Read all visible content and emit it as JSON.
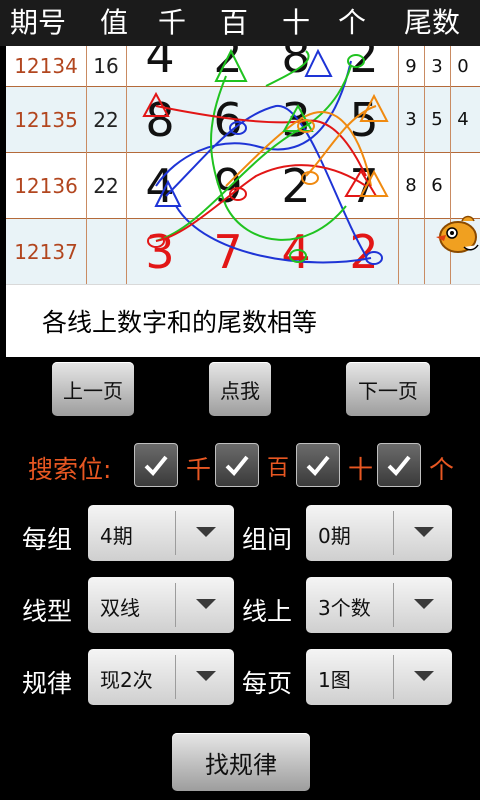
{
  "header": {
    "columns": [
      "期号",
      "值",
      "千",
      "百",
      "十",
      "个",
      "尾数"
    ]
  },
  "rows": [
    {
      "issue": "12134",
      "value": "16",
      "digits": [
        "4",
        "2",
        "8",
        "2"
      ],
      "tails": [
        "9",
        "3",
        "0"
      ]
    },
    {
      "issue": "12135",
      "value": "22",
      "digits": [
        "8",
        "6",
        "3",
        "5"
      ],
      "tails": [
        "3",
        "5",
        "4"
      ]
    },
    {
      "issue": "12136",
      "value": "22",
      "digits": [
        "4",
        "9",
        "2",
        "7"
      ],
      "tails": [
        "8",
        "6",
        ""
      ]
    },
    {
      "issue": "12137",
      "value": "",
      "digits": [
        "3",
        "7",
        "4",
        "2"
      ],
      "tails": [
        "",
        "",
        ""
      ]
    }
  ],
  "note": "各线上数字和的尾数相等",
  "buttons": {
    "prev": "上一页",
    "click": "点我",
    "next": "下一页",
    "find": "找规律"
  },
  "search": {
    "label": "搜索位:",
    "positions": [
      "千",
      "百",
      "十",
      "个"
    ]
  },
  "selects": {
    "per_group": {
      "label": "每组",
      "value": "4期"
    },
    "between": {
      "label": "组间",
      "value": "0期"
    },
    "line_type": {
      "label": "线型",
      "value": "双线"
    },
    "on_line": {
      "label": "线上",
      "value": "3个数"
    },
    "rule": {
      "label": "规律",
      "value": "现2次"
    },
    "per_page": {
      "label": "每页",
      "value": "1图"
    }
  },
  "colors": {
    "accent": "#e85722",
    "issue": "#b2461f",
    "red_digit": "#e21616"
  }
}
